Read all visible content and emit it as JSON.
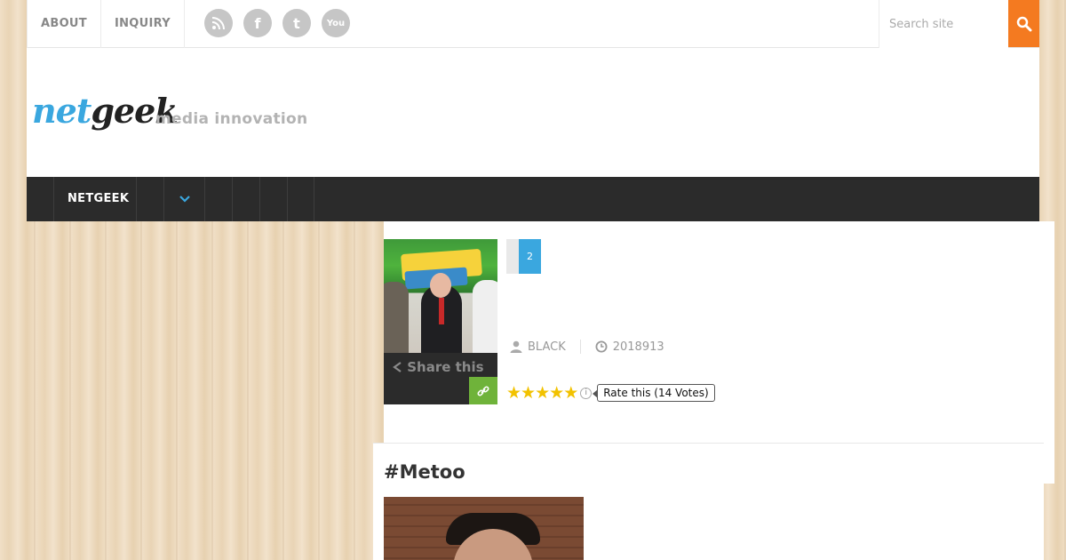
{
  "topbar": {
    "nav": [
      "ABOUT",
      "INQUIRY"
    ],
    "social": [
      {
        "icon": "rss-icon",
        "glyph": "●"
      },
      {
        "icon": "facebook-icon",
        "glyph": "f"
      },
      {
        "icon": "twitter-icon",
        "glyph": "t"
      },
      {
        "icon": "youtube-icon",
        "glyph": "You"
      }
    ],
    "search_placeholder": "Search site"
  },
  "header": {
    "logo_part1": "net",
    "logo_part2": "geek",
    "tagline": "media innovation"
  },
  "mainnav": {
    "home_label": "NETGEEK"
  },
  "article": {
    "pager": [
      "",
      "2"
    ],
    "author": "BLACK",
    "date": "2018913",
    "share_label": "Share this",
    "rating": {
      "stars": 5,
      "max": 5,
      "label": "Rate this (14 Votes)"
    }
  },
  "post": {
    "title": "#Metoo"
  },
  "colors": {
    "accent_blue": "#3aa7df",
    "search_orange": "#f47a20",
    "link_green": "#6fb33a",
    "nav_dark": "#2b2b2b",
    "star_gold": "#f2c200"
  }
}
